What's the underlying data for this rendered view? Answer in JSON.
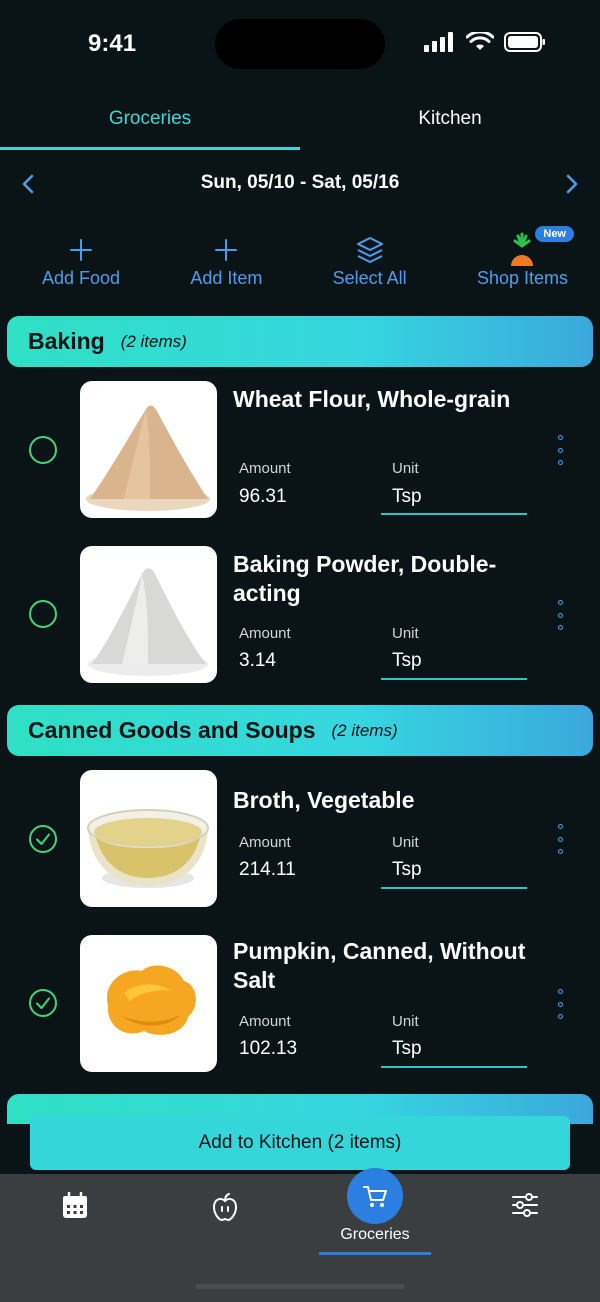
{
  "status_bar": {
    "time": "9:41"
  },
  "tabs": [
    {
      "label": "Groceries",
      "active": true
    },
    {
      "label": "Kitchen",
      "active": false
    }
  ],
  "date_range": "Sun, 05/10 - Sat, 05/16",
  "actions": {
    "add_food": "Add Food",
    "add_item": "Add Item",
    "select_all": "Select All",
    "shop_items": "Shop Items",
    "new_badge": "New"
  },
  "labels": {
    "amount": "Amount",
    "unit": "Unit"
  },
  "categories": [
    {
      "name": "Baking",
      "count": "(2 items)",
      "items": [
        {
          "name": "Wheat Flour, Whole-grain",
          "amount": "96.31",
          "unit": "Tsp",
          "checked": false,
          "icon": "flour-image"
        },
        {
          "name": "Baking Powder, Double-acting",
          "amount": "3.14",
          "unit": "Tsp",
          "checked": false,
          "icon": "powder-image"
        }
      ]
    },
    {
      "name": "Canned Goods and Soups",
      "count": "(2 items)",
      "items": [
        {
          "name": "Broth, Vegetable",
          "amount": "214.11",
          "unit": "Tsp",
          "checked": true,
          "icon": "broth-bowl-image"
        },
        {
          "name": "Pumpkin, Canned, Without Salt",
          "amount": "102.13",
          "unit": "Tsp",
          "checked": true,
          "icon": "pumpkin-puree-image"
        }
      ]
    }
  ],
  "add_to_kitchen": "Add to Kitchen (2 items)",
  "bottom_nav": {
    "active_label": "Groceries"
  },
  "colors": {
    "background": "#0a1416",
    "accent_teal": "#3fd6d6",
    "accent_blue": "#2a7fe0",
    "check_green": "#3fd67a"
  }
}
